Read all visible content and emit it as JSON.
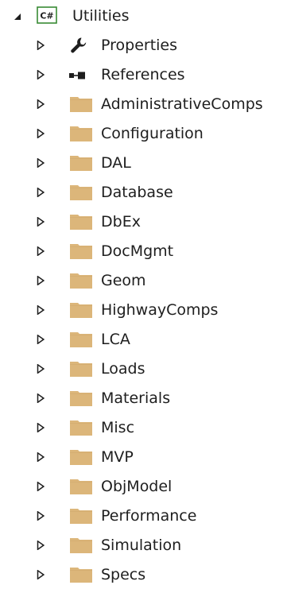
{
  "tree": {
    "root": {
      "label": "Utilities",
      "badge": "C#",
      "expanded": true,
      "icon": "csharp-project-icon"
    },
    "children": [
      {
        "label": "Properties",
        "icon": "wrench-icon"
      },
      {
        "label": "References",
        "icon": "references-icon"
      },
      {
        "label": "AdministrativeComps",
        "icon": "folder-icon"
      },
      {
        "label": "Configuration",
        "icon": "folder-icon"
      },
      {
        "label": "DAL",
        "icon": "folder-icon"
      },
      {
        "label": "Database",
        "icon": "folder-icon"
      },
      {
        "label": "DbEx",
        "icon": "folder-icon"
      },
      {
        "label": "DocMgmt",
        "icon": "folder-icon"
      },
      {
        "label": "Geom",
        "icon": "folder-icon"
      },
      {
        "label": "HighwayComps",
        "icon": "folder-icon"
      },
      {
        "label": "LCA",
        "icon": "folder-icon"
      },
      {
        "label": "Loads",
        "icon": "folder-icon"
      },
      {
        "label": "Materials",
        "icon": "folder-icon"
      },
      {
        "label": "Misc",
        "icon": "folder-icon"
      },
      {
        "label": "MVP",
        "icon": "folder-icon"
      },
      {
        "label": "ObjModel",
        "icon": "folder-icon"
      },
      {
        "label": "Performance",
        "icon": "folder-icon"
      },
      {
        "label": "Simulation",
        "icon": "folder-icon"
      },
      {
        "label": "Specs",
        "icon": "folder-icon"
      }
    ]
  },
  "colors": {
    "folder": "#dcb67a",
    "folder_dark": "#c9a063",
    "csharp_border": "#388a34",
    "arrow": "#1e1e1e",
    "text": "#1e1e1e"
  }
}
